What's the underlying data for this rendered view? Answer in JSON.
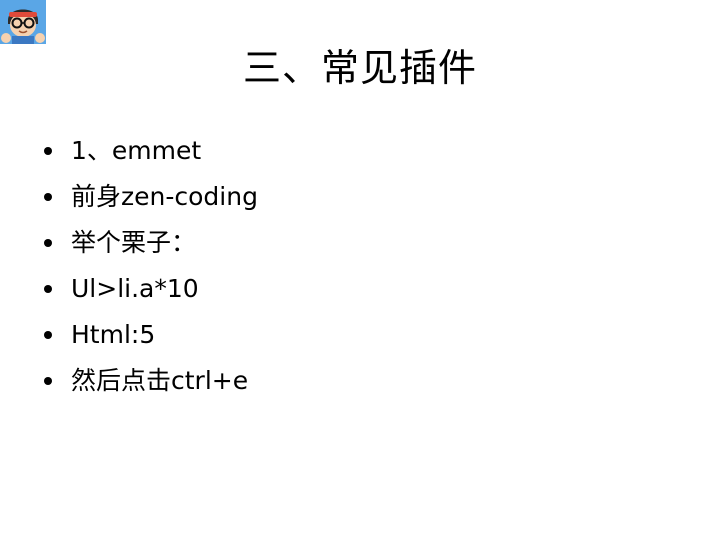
{
  "slide": {
    "title": "三、常见插件",
    "bullets": [
      "1、emmet",
      "前身zen-coding",
      "举个栗子：",
      "Ul>li.a*10",
      "Html:5",
      "然后点击ctrl+e"
    ]
  },
  "avatar": {
    "icon": "cartoon-avatar-icon"
  },
  "colors": {
    "background": "#ffffff",
    "text": "#000000"
  }
}
